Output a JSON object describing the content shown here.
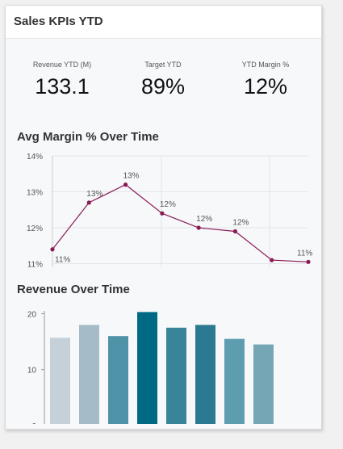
{
  "card": {
    "title": "Sales KPIs YTD"
  },
  "kpis": [
    {
      "label": "Revenue YTD (M)",
      "value": "133.1"
    },
    {
      "label": "Target YTD",
      "value": "89%"
    },
    {
      "label": "YTD Margin %",
      "value": "12%"
    }
  ],
  "line_chart": {
    "title": "Avg Margin % Over Time"
  },
  "bar_chart": {
    "title": "Revenue Over Time"
  },
  "colors": {
    "line": "#8a1a55",
    "bar_dark": "#006a85"
  },
  "chart_data": [
    {
      "type": "line",
      "title": "Avg Margin % Over Time",
      "y_ticks": [
        "14%",
        "13%",
        "12%",
        "11%"
      ],
      "ylim": [
        10.9,
        14.0
      ],
      "values": [
        11.4,
        12.7,
        13.2,
        12.4,
        12.0,
        11.9,
        11.1,
        11.05
      ],
      "data_labels": [
        "11%",
        "13%",
        "13%",
        "12%",
        "12%",
        "12%",
        "",
        "11%"
      ],
      "grid": true
    },
    {
      "type": "bar",
      "title": "Revenue Over Time",
      "y_ticks": [
        "20",
        "10",
        "0"
      ],
      "ylim": [
        0,
        20.5
      ],
      "values": [
        15.7,
        18.0,
        16.0,
        20.3,
        17.5,
        18.0,
        15.5,
        14.5
      ],
      "colors": [
        "#c5d0d8",
        "#a5bcc8",
        "#4f93a8",
        "#006a85",
        "#3a8499",
        "#2b7a91",
        "#5e9db0",
        "#75a6b6"
      ],
      "grid": false
    }
  ]
}
